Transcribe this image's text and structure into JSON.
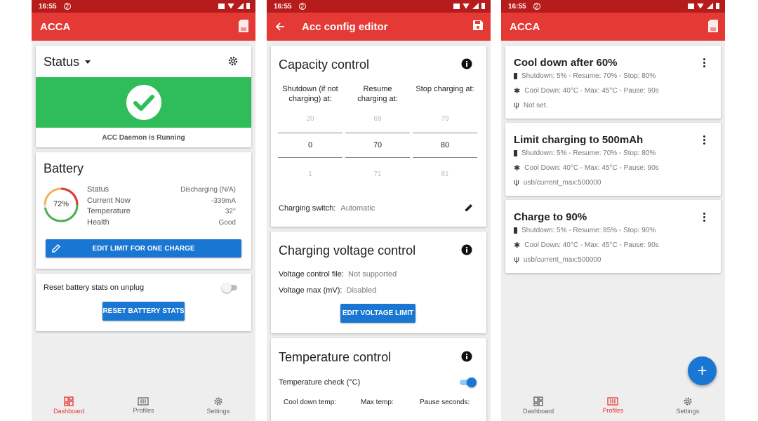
{
  "colors": {
    "status_bar": "#b71c1c",
    "app_bar": "#e53935",
    "running": "#2ebd59",
    "accent_blue": "#1976d2"
  },
  "status_bar": {
    "time": "16:55",
    "notif": "2"
  },
  "screen1": {
    "app_title": "ACCA",
    "status_card": {
      "title": "Status",
      "daemon_text": "ACC Daemon is Running"
    },
    "battery_card": {
      "title": "Battery",
      "percent": "72%",
      "percent_value": 72,
      "rows": [
        {
          "label": "Status",
          "value": "Discharging (N/A)"
        },
        {
          "label": "Current Now",
          "value": "-339mA"
        },
        {
          "label": "Temperature",
          "value": "32°"
        },
        {
          "label": "Health",
          "value": "Good"
        }
      ],
      "edit_button": "EDIT LIMIT FOR ONE CHARGE"
    },
    "reset_card": {
      "label": "Reset battery stats on unplug",
      "button": "RESET BATTERY STATS"
    }
  },
  "screen2": {
    "app_title": "Acc config editor",
    "capacity": {
      "title": "Capacity control",
      "col_headers": [
        "Shutdown (if not charging) at:",
        "Resume charging at:",
        "Stop charging at:"
      ],
      "columns": [
        {
          "above": "20",
          "selected": "0",
          "below": "1"
        },
        {
          "above": "69",
          "selected": "70",
          "below": "71"
        },
        {
          "above": "79",
          "selected": "80",
          "below": "81"
        }
      ],
      "switch_label": "Charging switch:",
      "switch_value": "Automatic"
    },
    "voltage": {
      "title": "Charging voltage control",
      "file_label": "Voltage control file:",
      "file_value": "Not supported",
      "max_label": "Voltage max (mV):",
      "max_value": "Disabled",
      "button": "EDIT VOLTAGE LIMIT"
    },
    "temperature": {
      "title": "Temperature control",
      "check_label": "Temperature check (°C)",
      "cols": [
        "Cool down temp:",
        "Max temp:",
        "Pause seconds:"
      ]
    }
  },
  "screen3": {
    "app_title": "ACCA",
    "profiles": [
      {
        "title": "Cool down after 60%",
        "line1": "Shutdown: 5% - Resume: 70% - Stop: 80%",
        "line2": "Cool Down: 40°C - Max: 45°C - Pause: 90s",
        "line3": "Not set."
      },
      {
        "title": "Limit charging to 500mAh",
        "line1": "Shutdown: 5% - Resume: 70% - Stop: 80%",
        "line2": "Cool Down: 40°C - Max: 45°C - Pause: 90s",
        "line3": "usb/current_max:500000"
      },
      {
        "title": "Charge to 90%",
        "line1": "Shutdown: 5% - Resume: 85% - Stop: 90%",
        "line2": "Cool Down: 40°C - Max: 45°C - Pause: 90s",
        "line3": "usb/current_max:500000"
      }
    ],
    "fab_label": "+"
  },
  "nav": {
    "dashboard": "Dashboard",
    "profiles": "Profiles",
    "settings": "Settings"
  }
}
